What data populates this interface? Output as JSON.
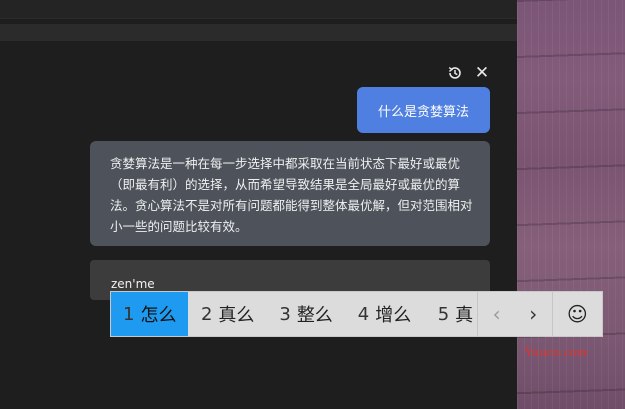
{
  "chat": {
    "user_message": "什么是贪婪算法",
    "assistant_message": "贪婪算法是一种在每一步选择中都采取在当前状态下最好或最优（即最有利）的选择，从而希望导致结果是全局最好或最优的算法。贪心算法不是对所有问题都能得到整体最优解，但对范围相对小一些的问题比较有效。",
    "input_value": "zen'me"
  },
  "header": {
    "history_icon": "history-icon",
    "close_symbol": "✕"
  },
  "ime": {
    "candidates": [
      {
        "num": "1",
        "text": "怎么"
      },
      {
        "num": "2",
        "text": "真么"
      },
      {
        "num": "3",
        "text": "整么"
      },
      {
        "num": "4",
        "text": "增么"
      },
      {
        "num": "5",
        "text": "真"
      }
    ],
    "prev_symbol": "‹",
    "next_symbol": "›",
    "emoji_symbol": "☺"
  },
  "watermark": "Yuucn.com",
  "colors": {
    "user_bubble": "#4f7fe0",
    "assistant_bubble": "#4d525b",
    "selected_candidate": "#1e9bf0",
    "watermark": "#e0332b"
  }
}
